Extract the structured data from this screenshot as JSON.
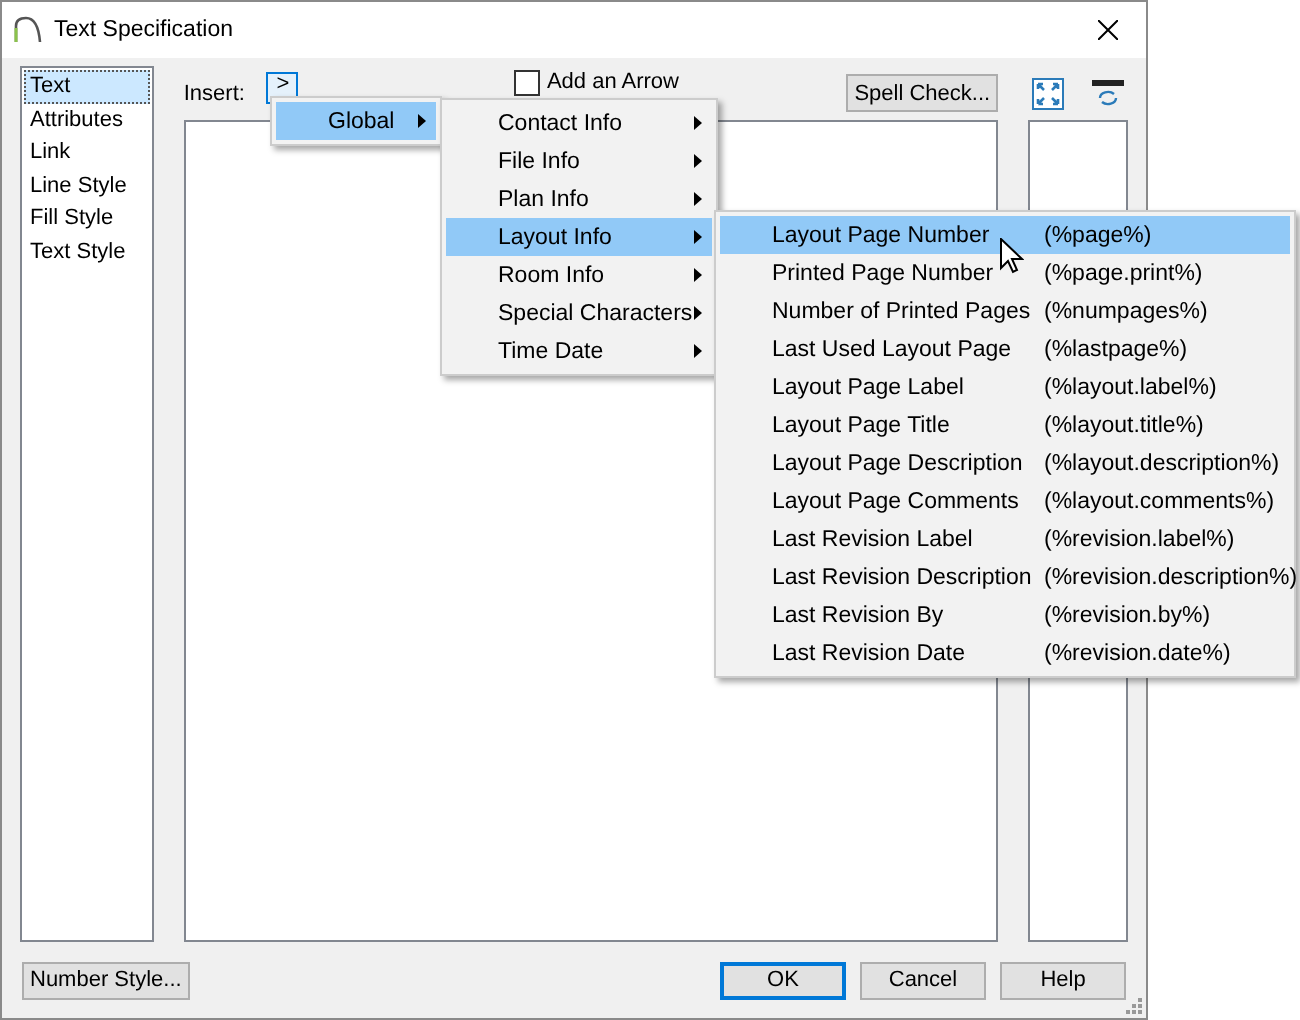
{
  "window": {
    "title": "Text Specification"
  },
  "sidebar": {
    "items": [
      {
        "label": "Text",
        "selected": true
      },
      {
        "label": "Attributes",
        "selected": false
      },
      {
        "label": "Link",
        "selected": false
      },
      {
        "label": "Line Style",
        "selected": false
      },
      {
        "label": "Fill Style",
        "selected": false
      },
      {
        "label": "Text Style",
        "selected": false
      }
    ]
  },
  "insert": {
    "label": "Insert:",
    "button": ">"
  },
  "add_arrow": {
    "label": "Add an Arrow",
    "checked": false
  },
  "spell_check": "Spell Check...",
  "buttons": [
    {
      "label": "Number Style...",
      "default": false
    },
    {
      "label": "OK",
      "default": true
    },
    {
      "label": "Cancel",
      "default": false
    },
    {
      "label": "Help",
      "default": false
    }
  ],
  "menus": [
    {
      "items": [
        {
          "label": "Global",
          "submenu": true,
          "selected": true
        }
      ]
    },
    {
      "items": [
        {
          "label": "Contact Info",
          "submenu": true,
          "selected": false
        },
        {
          "label": "File Info",
          "submenu": true,
          "selected": false
        },
        {
          "label": "Plan Info",
          "submenu": true,
          "selected": false
        },
        {
          "label": "Layout Info",
          "submenu": true,
          "selected": true
        },
        {
          "label": "Room Info",
          "submenu": true,
          "selected": false
        },
        {
          "label": "Special Characters",
          "submenu": true,
          "selected": false
        },
        {
          "label": "Time  Date",
          "submenu": true,
          "selected": false
        }
      ]
    },
    {
      "items": [
        {
          "label": "Layout Page Number",
          "shortcut": "(%page%)",
          "selected": true
        },
        {
          "label": "Printed Page Number",
          "shortcut": "(%page.print%)",
          "selected": false
        },
        {
          "label": "Number of Printed Pages",
          "shortcut": "(%numpages%)",
          "selected": false
        },
        {
          "label": "Last Used Layout Page",
          "shortcut": "(%lastpage%)",
          "selected": false
        },
        {
          "label": "Layout Page Label",
          "shortcut": "(%layout.label%)",
          "selected": false
        },
        {
          "label": "Layout Page Title",
          "shortcut": "(%layout.title%)",
          "selected": false
        },
        {
          "label": "Layout Page Description",
          "shortcut": "(%layout.description%)",
          "selected": false
        },
        {
          "label": "Layout Page Comments",
          "shortcut": "(%layout.comments%)",
          "selected": false
        },
        {
          "label": "Last Revision Label",
          "shortcut": "(%revision.label%)",
          "selected": false
        },
        {
          "label": "Last Revision Description",
          "shortcut": "(%revision.description%)",
          "selected": false
        },
        {
          "label": "Last Revision By",
          "shortcut": "(%revision.by%)",
          "selected": false
        },
        {
          "label": "Last Revision Date",
          "shortcut": "(%revision.date%)",
          "selected": false
        }
      ]
    }
  ]
}
